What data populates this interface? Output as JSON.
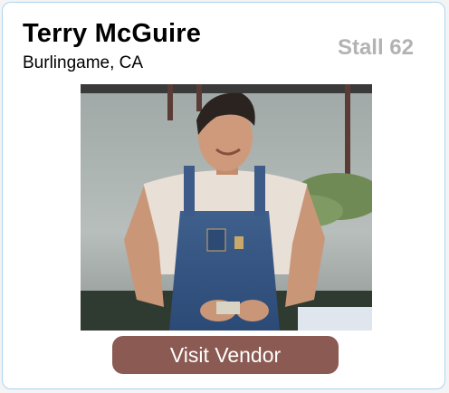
{
  "vendor": {
    "name": "Terry McGuire",
    "location": "Burlingame, CA",
    "stall": "Stall 62"
  },
  "photo": {
    "subject": "vendor-portrait"
  },
  "actions": {
    "visit_label": "Visit Vendor"
  },
  "colors": {
    "button_background": "#8b5a52",
    "stall_text": "#b3b3b3",
    "card_border": "#a9d6ef"
  }
}
